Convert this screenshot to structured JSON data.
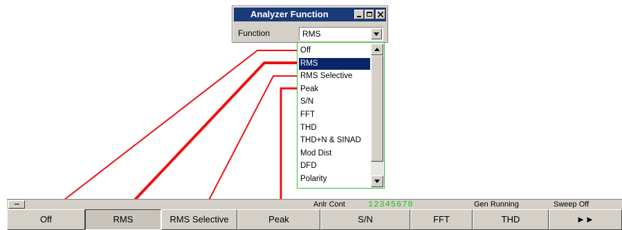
{
  "window": {
    "title": "Analyzer Function",
    "function_label": "Function",
    "function_value": "RMS"
  },
  "dropdown": {
    "selected": "RMS",
    "options": [
      "Off",
      "RMS",
      "RMS Selective",
      "Peak",
      "S/N",
      "FFT",
      "THD",
      "THD+N & SINAD",
      "Mod Dist",
      "DFD",
      "Polarity"
    ]
  },
  "statusbar": {
    "analyzer_label": "Anlr Cont",
    "analyzer_channels": "12345678",
    "generator_status": "Gen Running",
    "sweep_status": "Sweep Off"
  },
  "softkeys": [
    "Off",
    "RMS",
    "RMS Selective",
    "Peak",
    "S/N",
    "FFT",
    "THD",
    "►►"
  ],
  "active_softkey": "RMS",
  "colors": {
    "title_bar": "#1a3a78",
    "selection": "#0a246a",
    "connector_lines": "#ee1111",
    "dropdown_border": "#2bc02b",
    "channel_digits": "#22c022"
  }
}
